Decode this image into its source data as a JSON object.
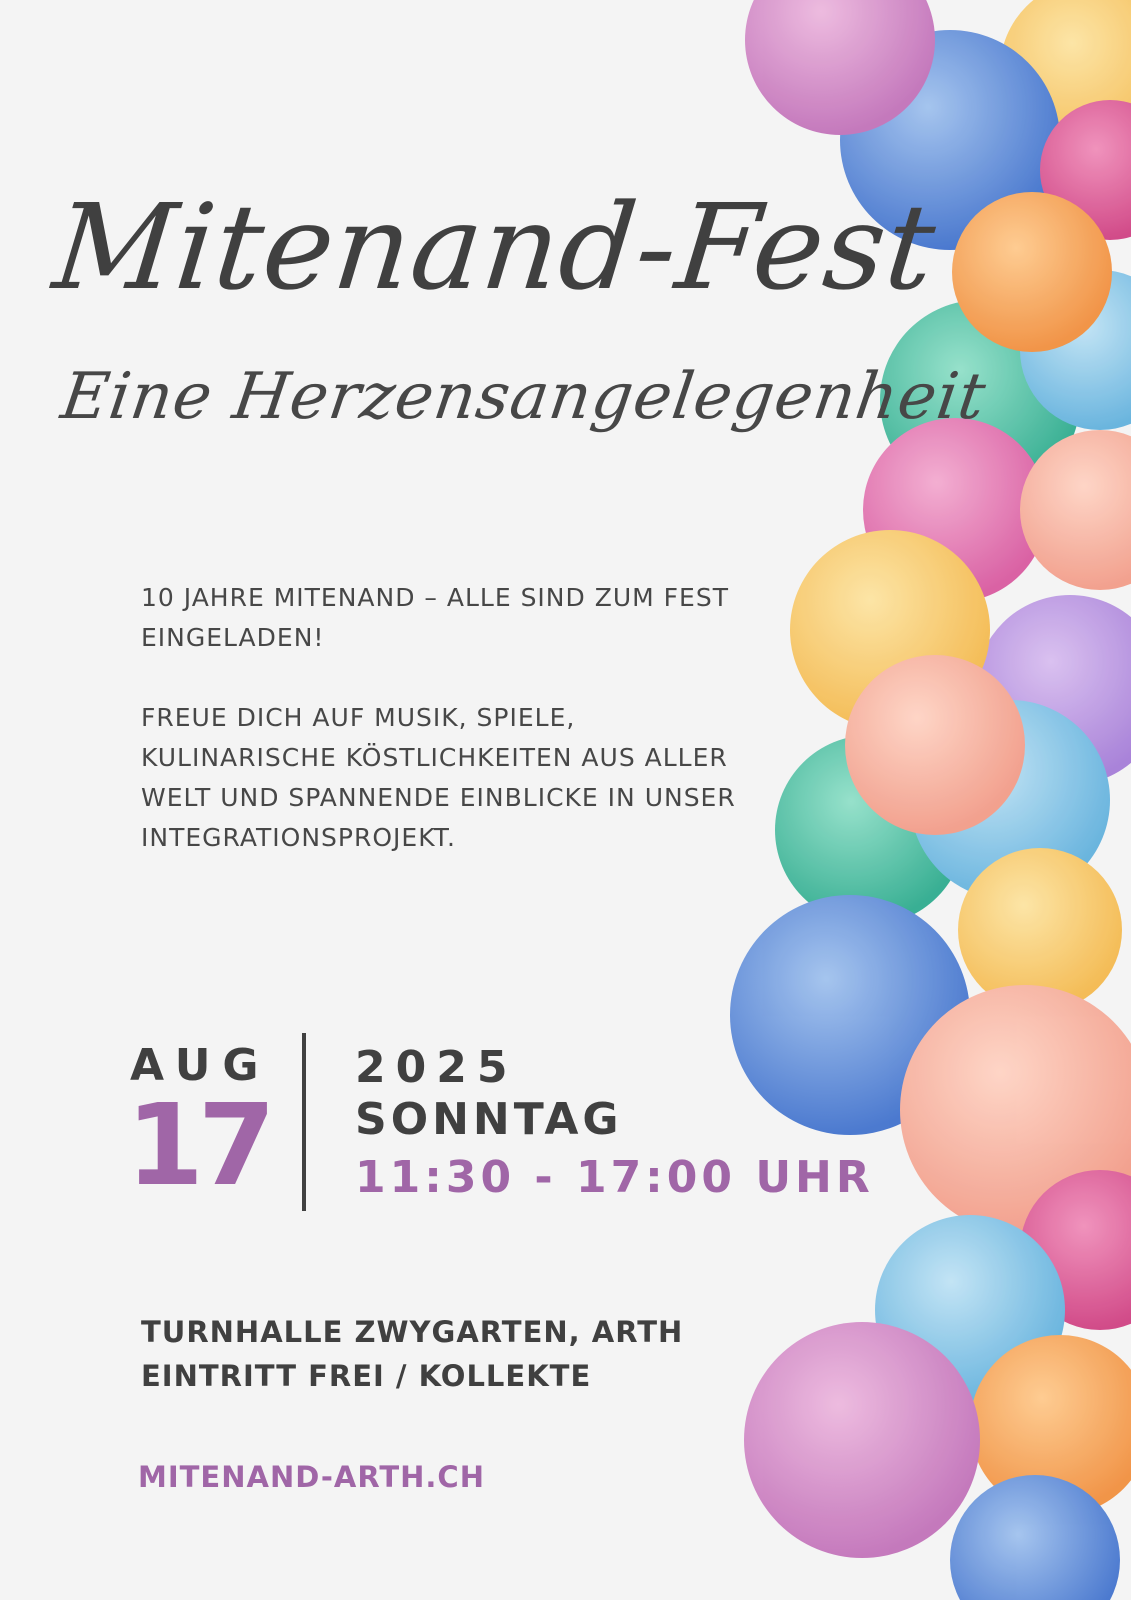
{
  "title": "Mitenand-Fest",
  "subtitle": "Eine Herzensangelegenheit",
  "intro": {
    "line1": "10 JAHRE MITENAND – ALLE SIND ZUM FEST EINGELADEN!",
    "line2": "FREUE DICH AUF MUSIK, SPIELE, KULINARISCHE KÖSTLICHKEITEN AUS ALLER WELT UND SPANNENDE EINBLICKE IN UNSER INTEGRATIONSPROJEKT."
  },
  "date": {
    "month": "AUG",
    "day": "17",
    "year": "2025",
    "weekday": "SONNTAG",
    "time": "11:30 - 17:00 UHR"
  },
  "venue": {
    "location": "TURNHALLE ZWYGARTEN, ARTH",
    "admission": "EINTRITT FREI / KOLLEKTE"
  },
  "website": "MITENAND-ARTH.CH",
  "colors": {
    "background": "#f4f4f4",
    "text": "#404040",
    "accent": "#a066a7"
  }
}
